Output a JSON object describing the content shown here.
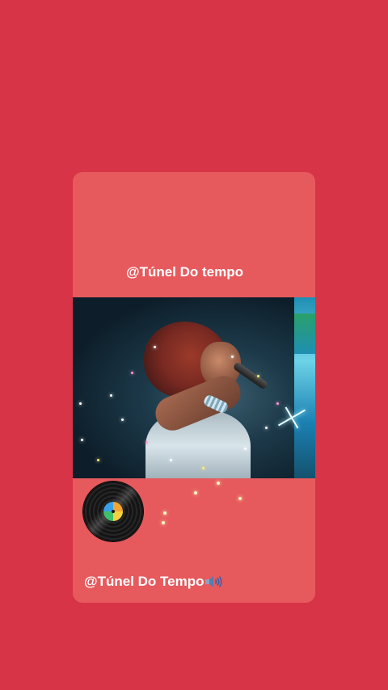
{
  "post": {
    "top_caption": "@Túnel Do tempo",
    "bottom_caption": "@Túnel Do Tempo",
    "bottom_caption_icon": "speaker-loud-icon"
  },
  "colors": {
    "background": "#d73448",
    "card": "#e65a5d",
    "text": "#ffffff"
  }
}
